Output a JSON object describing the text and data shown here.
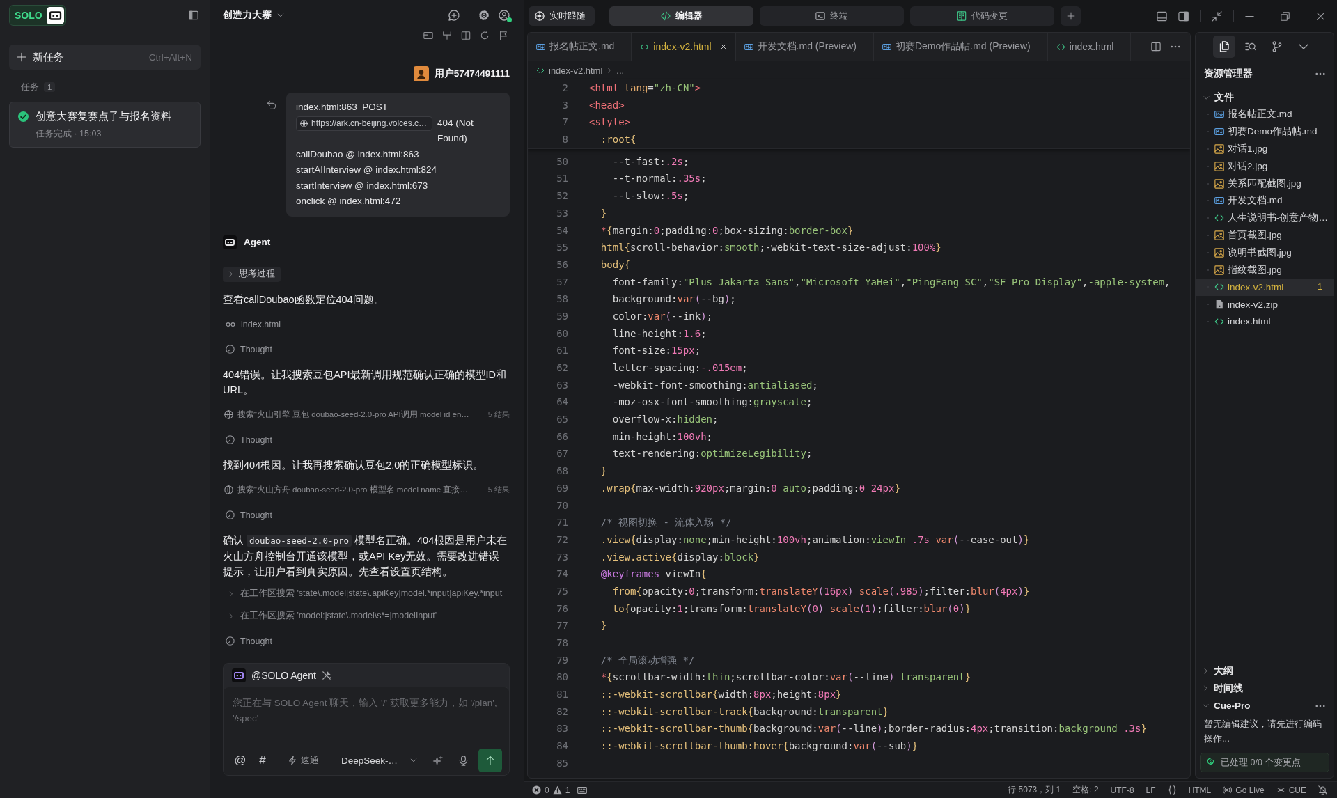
{
  "sidebar": {
    "logo": "SOLO",
    "new_task": {
      "label": "新任务",
      "shortcut": "Ctrl+Alt+N"
    },
    "tasks_label": "任务",
    "tasks_count": "1",
    "tasks": [
      {
        "title": "创意大赛复赛点子与报名资料",
        "status": "任务完成 · 15:03",
        "done": true,
        "selected": true
      }
    ]
  },
  "chat": {
    "title": "创造力大赛",
    "account": {
      "online": true
    },
    "user": {
      "name": "用户57474491111"
    },
    "message": {
      "first_line": "index.html:863  POST",
      "link": "https://ark.cn-beijing.volces.c…",
      "after_link": "404 (Not Found)",
      "lines": [
        "callDoubao @ index.html:863",
        "startAIInterview @ index.html:824",
        "startInterview @ index.html:673",
        "onclick @ index.html:472"
      ]
    },
    "agent": {
      "name": "Agent"
    },
    "steps": [
      {
        "kind": "toggle",
        "label": "思考过程",
        "expanded": false
      },
      {
        "kind": "paragraph",
        "segments": [
          {
            "kind": "text",
            "text": "查看callDoubao函数定位404问题。"
          }
        ]
      },
      {
        "kind": "file",
        "label": "index.html"
      },
      {
        "kind": "thought",
        "label": "Thought"
      },
      {
        "kind": "paragraph",
        "segments": [
          {
            "kind": "text",
            "text": "404错误。让我搜索豆包API最新调用规范确认正确的模型ID和URL。"
          }
        ]
      },
      {
        "kind": "search",
        "label": "搜索“火山引擎 豆包 doubao-seed-2.0-pro API调用 model id en…",
        "count": "5 结果"
      },
      {
        "kind": "thought",
        "label": "Thought"
      },
      {
        "kind": "paragraph",
        "segments": [
          {
            "kind": "text",
            "text": "找到404根因。让我再搜索确认豆包2.0的正确模型标识。"
          }
        ]
      },
      {
        "kind": "search",
        "label": "搜索“火山方舟 doubao-seed-2.0-pro 模型名 model name 直接…",
        "count": "5 结果"
      },
      {
        "kind": "thought",
        "label": "Thought"
      },
      {
        "kind": "paragraph",
        "segments": [
          {
            "kind": "text",
            "text": "确认 "
          },
          {
            "kind": "code",
            "text": "doubao-seed-2.0-pro"
          },
          {
            "kind": "text",
            "text": " 模型名正确。404根因是用户未在火山方舟控制台开通该模型，或API Key无效。需要改进错误提示，让用户看到真实原因。先查看设置页结构。"
          }
        ]
      },
      {
        "kind": "workspace_search",
        "label": "在工作区搜索 'state\\.model|state\\.apiKey|model.*input|apiKey.*input'",
        "expanded": false
      },
      {
        "kind": "workspace_search",
        "label": "在工作区搜索 'model:|state\\.model\\s*=|modelInput'",
        "expanded": false
      },
      {
        "kind": "thought",
        "label": "Thought"
      }
    ],
    "composer": {
      "mention": "@SOLO Agent",
      "placeholder": "您正在与 SOLO Agent 聊天，输入 '/' 获取更多能力，如 '/plan', '/spec'",
      "tools": [
        "@",
        "#"
      ],
      "mode": "速通",
      "model": "DeepSeek-…"
    }
  },
  "editor": {
    "follow": "实时跟随",
    "view_tabs": [
      {
        "label": "编辑器",
        "kind": "code",
        "selected": true
      },
      {
        "label": "终端",
        "kind": "terminal",
        "selected": false
      },
      {
        "label": "代码变更",
        "kind": "changes",
        "selected": false
      }
    ],
    "tabs": [
      {
        "label": "报名帖正文.md",
        "kind": "markdown",
        "selected": false,
        "warning": false
      },
      {
        "label": "index-v2.html",
        "kind": "html",
        "selected": true,
        "warning": true
      },
      {
        "label": "开发文档.md (Preview)",
        "kind": "markdown",
        "selected": false,
        "warning": false
      },
      {
        "label": "初赛Demo作品帖.md (Preview)",
        "kind": "markdown",
        "selected": false,
        "warning": false
      },
      {
        "label": "index.html",
        "kind": "html",
        "selected": false,
        "warning": false
      }
    ],
    "breadcrumb": {
      "file": "index-v2.html",
      "more": "..."
    },
    "sticky_lines": [
      {
        "number": "2",
        "text": "<html lang=\"zh-CN\">"
      },
      {
        "number": "3",
        "text": "<head>"
      },
      {
        "number": "7",
        "text": "<style>"
      },
      {
        "number": "8",
        "text": "  :root{"
      }
    ],
    "lines": [
      {
        "number": "50",
        "text": "    --t-fast:.2s;"
      },
      {
        "number": "51",
        "text": "    --t-normal:.35s;"
      },
      {
        "number": "52",
        "text": "    --t-slow:.5s;"
      },
      {
        "number": "53",
        "text": "  }"
      },
      {
        "number": "54",
        "text": "  *{margin:0;padding:0;box-sizing:border-box}"
      },
      {
        "number": "55",
        "text": "  html{scroll-behavior:smooth;-webkit-text-size-adjust:100%}"
      },
      {
        "number": "56",
        "text": "  body{"
      },
      {
        "number": "57",
        "text": "    font-family:\"Plus Jakarta Sans\",\"Microsoft YaHei\",\"PingFang SC\",\"SF Pro Display\",-apple-system,"
      },
      {
        "number": "58",
        "text": "    background:var(--bg);"
      },
      {
        "number": "59",
        "text": "    color:var(--ink);"
      },
      {
        "number": "60",
        "text": "    line-height:1.6;"
      },
      {
        "number": "61",
        "text": "    font-size:15px;"
      },
      {
        "number": "62",
        "text": "    letter-spacing:-.015em;"
      },
      {
        "number": "63",
        "text": "    -webkit-font-smoothing:antialiased;"
      },
      {
        "number": "64",
        "text": "    -moz-osx-font-smoothing:grayscale;"
      },
      {
        "number": "65",
        "text": "    overflow-x:hidden;"
      },
      {
        "number": "66",
        "text": "    min-height:100vh;"
      },
      {
        "number": "67",
        "text": "    text-rendering:optimizeLegibility;"
      },
      {
        "number": "68",
        "text": "  }"
      },
      {
        "number": "69",
        "text": "  .wrap{max-width:920px;margin:0 auto;padding:0 24px}"
      },
      {
        "number": "70"
      },
      {
        "number": "71",
        "text": "  /* 视图切换 - 流体入场 */"
      },
      {
        "number": "72",
        "text": "  .view{display:none;min-height:100vh;animation:viewIn .7s var(--ease-out)}"
      },
      {
        "number": "73",
        "text": "  .view.active{display:block}"
      },
      {
        "number": "74",
        "text": "  @keyframes viewIn{"
      },
      {
        "number": "75",
        "text": "    from{opacity:0;transform:translateY(16px) scale(.985);filter:blur(4px)}"
      },
      {
        "number": "76",
        "text": "    to{opacity:1;transform:translateY(0) scale(1);filter:blur(0)}"
      },
      {
        "number": "77",
        "text": "  }"
      },
      {
        "number": "78"
      },
      {
        "number": "79",
        "text": "  /* 全局滚动增强 */"
      },
      {
        "number": "80",
        "text": "  *{scrollbar-width:thin;scrollbar-color:var(--line) transparent}"
      },
      {
        "number": "81",
        "text": "  ::-webkit-scrollbar{width:8px;height:8px}"
      },
      {
        "number": "82",
        "text": "  ::-webkit-scrollbar-track{background:transparent}"
      },
      {
        "number": "83",
        "text": "  ::-webkit-scrollbar-thumb{background:var(--line);border-radius:4px;transition:background .3s}"
      },
      {
        "number": "84",
        "text": "  ::-webkit-scrollbar-thumb:hover{background:var(--sub)}"
      },
      {
        "number": "85"
      }
    ]
  },
  "explorer": {
    "activity": [
      {
        "kind": "files",
        "selected": true
      },
      {
        "kind": "search",
        "selected": false
      },
      {
        "kind": "source_control",
        "selected": false
      }
    ],
    "title": "资源管理器",
    "folder": {
      "label": "文件",
      "expanded": true,
      "children": [
        {
          "label": "报名帖正文.md",
          "kind": "markdown",
          "selected": false,
          "warning": false
        },
        {
          "label": "初赛Demo作品帖.md",
          "kind": "markdown",
          "selected": false,
          "warning": false
        },
        {
          "label": "对话1.jpg",
          "kind": "image",
          "selected": false,
          "warning": false
        },
        {
          "label": "对话2.jpg",
          "kind": "image",
          "selected": false,
          "warning": false
        },
        {
          "label": "关系匹配截图.jpg",
          "kind": "image",
          "selected": false,
          "warning": false
        },
        {
          "label": "开发文档.md",
          "kind": "markdown",
          "selected": false,
          "warning": false
        },
        {
          "label": "人生说明书-创意产物…",
          "kind": "html",
          "selected": false,
          "warning": false
        },
        {
          "label": "首页截图.jpg",
          "kind": "image",
          "selected": false,
          "warning": false
        },
        {
          "label": "说明书截图.jpg",
          "kind": "image",
          "selected": false,
          "warning": false
        },
        {
          "label": "指纹截图.jpg",
          "kind": "image",
          "selected": false,
          "warning": false
        },
        {
          "label": "index-v2.html",
          "kind": "html",
          "selected": true,
          "warning": true,
          "problems": "1"
        },
        {
          "label": "index-v2.zip",
          "kind": "archive",
          "selected": false,
          "warning": false
        },
        {
          "label": "index.html",
          "kind": "html",
          "selected": false,
          "warning": false
        }
      ]
    },
    "sections": [
      {
        "label": "大纲",
        "expanded": false
      },
      {
        "label": "时间线",
        "expanded": false
      },
      {
        "label": "Cue-Pro",
        "expanded": true,
        "message": "暂无编辑建议，请先进行编码操作...",
        "status": "已处理 0/0 个变更点"
      }
    ]
  },
  "status_bar": {
    "errors": "0",
    "warnings": "1",
    "cursor": "行 5073，列 1",
    "indent": "空格: 2",
    "encoding": "UTF-8",
    "eol": "LF",
    "language": "HTML",
    "live": "Go Live",
    "extension": "CUE"
  }
}
